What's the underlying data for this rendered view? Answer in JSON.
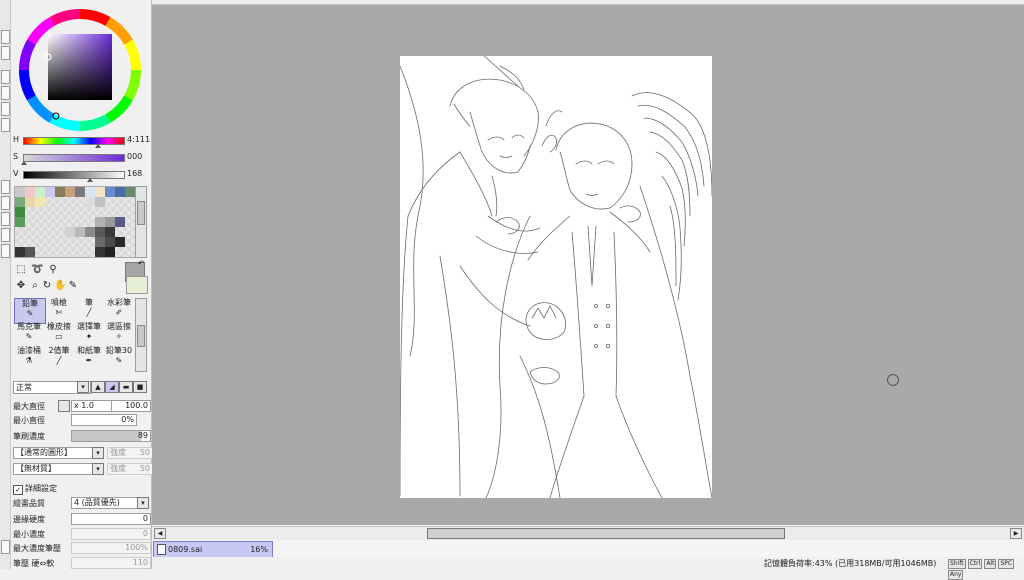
{
  "color": {
    "h_label": "H",
    "h_value": "4:111",
    "s_label": "S",
    "s_value": "000",
    "v_label": "V",
    "v_value": "168",
    "main_color": "#a6a6a6",
    "sub_color": "#e6efd6"
  },
  "swatches": [
    "#c9c9c9",
    "#f2c9c9",
    "#c9f2c9",
    "#c9c9f2",
    "#8a7a5a",
    "#c9a07a",
    "#7a7a7a",
    "#d9e6f2",
    "#f2e6c9",
    "#6a8ac9",
    "#4a6aa9",
    "#6a8a6a",
    "#7aa97a",
    "#e6d9a9",
    "#f2e6b0",
    "",
    "",
    "",
    "",
    "#dcdcdc",
    "#c0c0c0",
    "",
    "",
    "",
    "#3d8a3d",
    "",
    "",
    "",
    "",
    "",
    "",
    "",
    "",
    "",
    "",
    "",
    "#5a9a5a",
    "",
    "",
    "",
    "",
    "",
    "",
    "",
    "#b0b0b0",
    "#9a9a9a",
    "#5a5a8a",
    "",
    "",
    "",
    "",
    "",
    "",
    "#d0d0d0",
    "#bababa",
    "#8a8a8a",
    "#5a5a5a",
    "#3a3a3a",
    "",
    "",
    "",
    "",
    "",
    "",
    "",
    "",
    "",
    "",
    "#6a6a6a",
    "#4a4a4a",
    "#2a2a2a",
    "",
    "#333333",
    "#555555",
    "",
    "",
    "",
    "",
    "",
    "",
    "#333333",
    "#222222",
    "",
    ""
  ],
  "brushes": [
    {
      "name": "鉛筆",
      "selected": true
    },
    {
      "name": "噴槍",
      "selected": false
    },
    {
      "name": "筆",
      "selected": false
    },
    {
      "name": "水彩筆",
      "selected": false
    },
    {
      "name": "馬克筆",
      "selected": false
    },
    {
      "name": "橡皮擦",
      "selected": false
    },
    {
      "name": "選擇筆",
      "selected": false
    },
    {
      "name": "選區擦",
      "selected": false
    },
    {
      "name": "油漆桶",
      "selected": false
    },
    {
      "name": "2值筆",
      "selected": false
    },
    {
      "name": "和紙筆",
      "selected": false
    },
    {
      "name": "鉛筆30",
      "selected": false
    }
  ],
  "brush_settings": {
    "blend_mode": "正常",
    "max_size_label": "最大直徑",
    "max_size_multiplier": "x 1.0",
    "max_size_value": "100.0",
    "min_size_label": "最小直徑",
    "min_size_value": "0%",
    "density_label": "筆刷濃度",
    "density_value": "89",
    "shape_select": "【通常的圓形】",
    "shape_strength_label": "強度",
    "shape_strength_value": "50",
    "texture_select": "【無材質】",
    "texture_strength_label": "強度",
    "texture_strength_value": "50",
    "advanced_label": "詳細設定",
    "quality_label": "繪畫品質",
    "quality_value": "4 (品質優先)",
    "edge_label": "邊緣硬度",
    "edge_value": "0",
    "min_density_label": "最小濃度",
    "min_density_value": "0",
    "max_pressure_label": "最大濃度筆壓",
    "max_pressure_value": "100%",
    "pressure_label": "筆壓 硬⇔軟",
    "pressure_value": "110"
  },
  "file_tab": {
    "name": "0809.sai",
    "zoom": "16%"
  },
  "status": {
    "memory": "記憶體負荷率:43% (已用318MB/可用1046MB)",
    "keys": [
      "Shift",
      "Ctrl",
      "Alt",
      "SPC",
      "Any"
    ]
  }
}
